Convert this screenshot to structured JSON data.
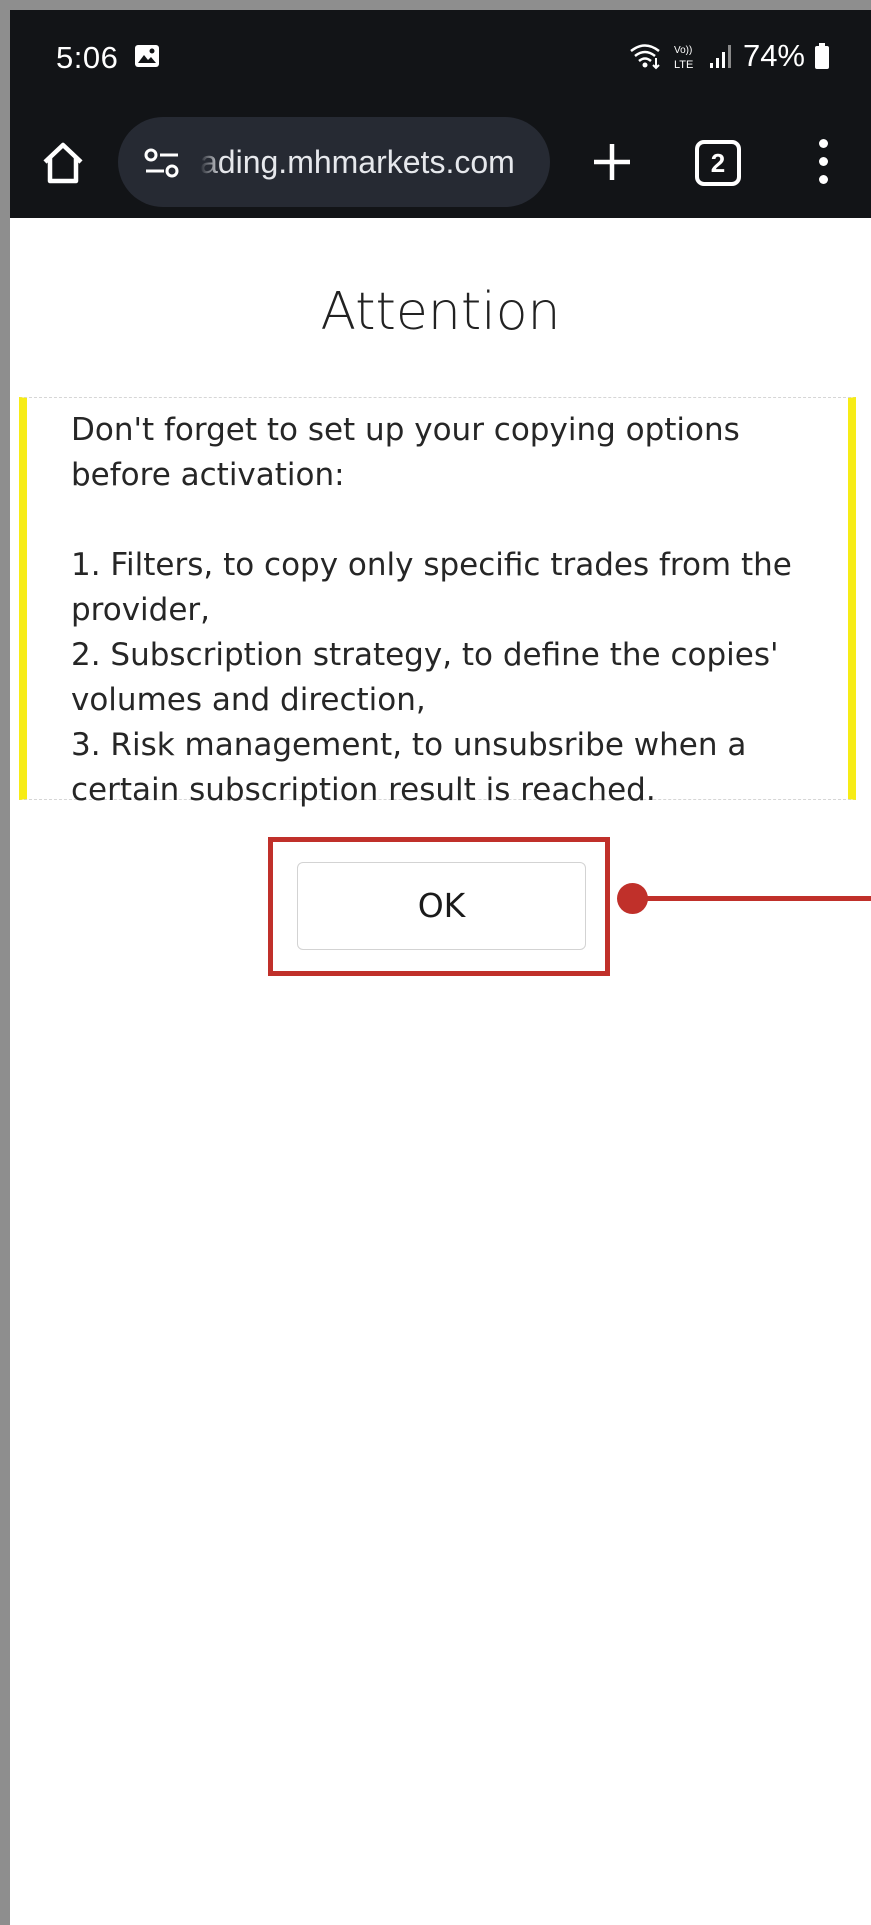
{
  "status_bar": {
    "time": "5:06",
    "battery": "74%",
    "icons": [
      "photo-icon",
      "wifi-icon",
      "volte-icon",
      "signal-icon",
      "battery-icon"
    ]
  },
  "browser": {
    "url": "ading.mhmarkets.com",
    "tab_count": "2",
    "icons": [
      "home-icon",
      "site-settings-icon",
      "plus-icon",
      "tabs-icon",
      "more-vert-icon"
    ]
  },
  "dialog": {
    "title": "Attention",
    "intro": "Don't forget to set up your copying options before activation:",
    "items": [
      "1. Filters, to copy only specific trades from the provider,",
      "2. Subscription strategy, to define the copies' volumes and direction,",
      "3. Risk management, to unsubsribe when a certain subscription result is reached."
    ],
    "ok_label": "OK"
  },
  "colors": {
    "accent_border": "#f7ec16",
    "highlight": "#c0302a",
    "toolbar": "#121417"
  }
}
